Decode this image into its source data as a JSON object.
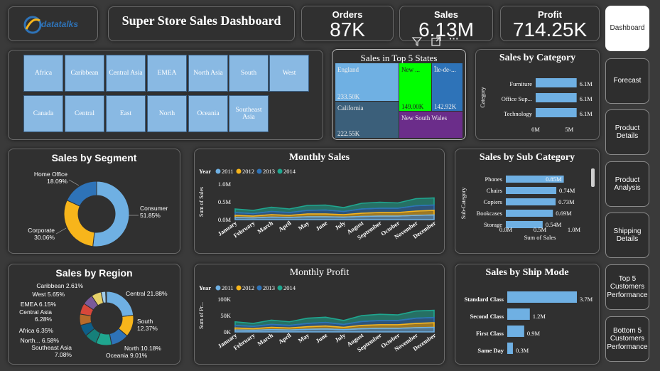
{
  "logo": {
    "text": "datatalks"
  },
  "header": {
    "title": "Super Store Sales Dashboard"
  },
  "kpis": {
    "orders": {
      "label": "Orders",
      "value": "87K"
    },
    "sales": {
      "label": "Sales",
      "value": "6.13M"
    },
    "profit": {
      "label": "Profit",
      "value": "714.25K"
    }
  },
  "nav": [
    {
      "label": "Dashboard",
      "active": true
    },
    {
      "label": "Forecast"
    },
    {
      "label": "Product Details"
    },
    {
      "label": "Product Analysis"
    },
    {
      "label": "Shipping Details"
    },
    {
      "label": "Top 5 Customers Performance"
    },
    {
      "label": "Bottom 5 Customers Performance"
    }
  ],
  "region_slicer": [
    "Africa",
    "Caribbean",
    "Central Asia",
    "EMEA",
    "North Asia",
    "South",
    "West",
    "Canada",
    "Central",
    "East",
    "North",
    "Oceania",
    "Southeast Asia"
  ],
  "visual_toolbar": {
    "icons": [
      "filter-icon",
      "focus-mode-icon",
      "more-options-icon"
    ],
    "more_label": "···"
  },
  "colors": {
    "blue": "#6fb0e3",
    "orange": "#f7b51b",
    "darkblue": "#2e73b8",
    "teal": "#1fa68f",
    "green": "#00ff00",
    "purple": "#6b2d8a",
    "slate": "#3b5f7a"
  },
  "chart_data": [
    {
      "id": "top5_states",
      "type": "treemap",
      "title": "Sales in Top 5 States",
      "items": [
        {
          "name": "England",
          "value": 233.5,
          "label": "233.50K",
          "color": "#6fb0e3"
        },
        {
          "name": "California",
          "value": 222.55,
          "label": "222.55K",
          "color": "#3b5f7a"
        },
        {
          "name": "New ...",
          "value": 149.0,
          "label": "149.00K",
          "color": "#00ff00"
        },
        {
          "name": "Île-de-...",
          "value": 142.92,
          "label": "142.92K",
          "color": "#2e73b8"
        },
        {
          "name": "New South Wales",
          "value": 140.0,
          "label": "",
          "color": "#6b2d8a"
        }
      ]
    },
    {
      "id": "by_category",
      "type": "bar",
      "orientation": "horizontal",
      "title": "Sales by Category",
      "ylabel": "Category",
      "categories": [
        "Furniture",
        "Office Sup...",
        "Technology"
      ],
      "values": [
        6.1,
        6.1,
        6.1
      ],
      "value_labels": [
        "6.1M",
        "6.1M",
        "6.1M"
      ],
      "xticks": [
        "0M",
        "5M"
      ],
      "xlim": [
        0,
        5.5
      ]
    },
    {
      "id": "by_segment",
      "type": "pie",
      "title": "Sales by Segment",
      "slices": [
        {
          "name": "Consumer",
          "value": 51.85,
          "label": "51.85%",
          "color": "#6fb0e3"
        },
        {
          "name": "Corporate",
          "value": 30.06,
          "label": "30.06%",
          "color": "#f7b51b"
        },
        {
          "name": "Home Office",
          "value": 18.09,
          "label": "18.09%",
          "color": "#2e73b8"
        }
      ]
    },
    {
      "id": "monthly_sales",
      "type": "area",
      "title": "Monthly Sales",
      "ylabel": "Sum of Sales",
      "legend_title": "Year",
      "categories": [
        "January",
        "February",
        "March",
        "April",
        "May",
        "June",
        "July",
        "August",
        "September",
        "October",
        "November",
        "December"
      ],
      "yticks": [
        "0.0M",
        "0.5M",
        "1.0M"
      ],
      "ylim": [
        0,
        1.0
      ],
      "series": [
        {
          "name": "2011",
          "color": "#6fb0e3",
          "values": [
            0.06,
            0.05,
            0.07,
            0.06,
            0.08,
            0.08,
            0.07,
            0.09,
            0.1,
            0.1,
            0.12,
            0.13
          ]
        },
        {
          "name": "2012",
          "color": "#f7b51b",
          "values": [
            0.06,
            0.05,
            0.07,
            0.06,
            0.08,
            0.08,
            0.07,
            0.09,
            0.1,
            0.1,
            0.12,
            0.13
          ]
        },
        {
          "name": "2013",
          "color": "#2e73b8",
          "values": [
            0.08,
            0.07,
            0.09,
            0.08,
            0.1,
            0.11,
            0.09,
            0.12,
            0.12,
            0.12,
            0.15,
            0.15
          ]
        },
        {
          "name": "2014",
          "color": "#1fa68f",
          "values": [
            0.1,
            0.09,
            0.12,
            0.1,
            0.14,
            0.14,
            0.11,
            0.16,
            0.17,
            0.15,
            0.2,
            0.2
          ]
        }
      ]
    },
    {
      "id": "by_subcategory",
      "type": "bar",
      "orientation": "horizontal",
      "title": "Sales by Sub Category",
      "ylabel": "Sub-Category",
      "xlabel": "Sum of Sales",
      "categories": [
        "Phones",
        "Chairs",
        "Copiers",
        "Bookcases",
        "Storage"
      ],
      "values": [
        0.85,
        0.74,
        0.73,
        0.69,
        0.54
      ],
      "value_labels": [
        "0.85M",
        "0.74M",
        "0.73M",
        "0.69M",
        "0.54M"
      ],
      "xticks": [
        "0.0M",
        "0.5M",
        "1.0M"
      ],
      "xlim": [
        0,
        1.0
      ]
    },
    {
      "id": "by_region",
      "type": "pie",
      "title": "Sales by Region",
      "slices": [
        {
          "name": "Central",
          "value": 21.88,
          "label": "Central 21.88%",
          "color": "#6fb0e3"
        },
        {
          "name": "South",
          "value": 12.37,
          "label": "South 12.37%",
          "color": "#f7b51b"
        },
        {
          "name": "North",
          "value": 10.18,
          "label": "North 10.18%",
          "color": "#2e73b8"
        },
        {
          "name": "Oceania",
          "value": 9.01,
          "label": "Oceania 9.01%",
          "color": "#1fa68f"
        },
        {
          "name": "Southeast Asia",
          "value": 7.08,
          "label": "Southeast Asia 7.08%",
          "color": "#16807a"
        },
        {
          "name": "North...",
          "value": 6.58,
          "label": "North... 6.58%",
          "color": "#0e5e88"
        },
        {
          "name": "Africa",
          "value": 6.35,
          "label": "Africa 6.35%",
          "color": "#b86b2a"
        },
        {
          "name": "Central Asia",
          "value": 6.28,
          "label": "Central Asia 6.28%",
          "color": "#d8473a"
        },
        {
          "name": "EMEA",
          "value": 6.15,
          "label": "EMEA 6.15%",
          "color": "#7a5a9a"
        },
        {
          "name": "West",
          "value": 5.65,
          "label": "West 5.65%",
          "color": "#e6d069"
        },
        {
          "name": "Caribbean",
          "value": 2.61,
          "label": "Caribbean 2.61%",
          "color": "#a0cbe8"
        },
        {
          "name": "Canada",
          "value": 0.5,
          "label": "",
          "color": "#56b4a4"
        }
      ]
    },
    {
      "id": "monthly_profit",
      "type": "area",
      "title": "Monthly Profit",
      "ylabel": "Sum of Pr...",
      "legend_title": "Year",
      "categories": [
        "January",
        "February",
        "March",
        "April",
        "May",
        "June",
        "July",
        "August",
        "September",
        "October",
        "November",
        "December"
      ],
      "yticks": [
        "0K",
        "50K",
        "100K"
      ],
      "ylim": [
        0,
        100
      ],
      "series": [
        {
          "name": "2011",
          "color": "#6fb0e3",
          "values": [
            6,
            5,
            7,
            6,
            8,
            9,
            7,
            10,
            11,
            11,
            13,
            14
          ]
        },
        {
          "name": "2012",
          "color": "#f7b51b",
          "values": [
            6,
            5,
            7,
            6,
            8,
            9,
            7,
            10,
            11,
            11,
            13,
            14
          ]
        },
        {
          "name": "2013",
          "color": "#2e73b8",
          "values": [
            8,
            7,
            9,
            8,
            10,
            11,
            9,
            12,
            13,
            13,
            16,
            16
          ]
        },
        {
          "name": "2014",
          "color": "#1fa68f",
          "values": [
            11,
            9,
            13,
            11,
            16,
            16,
            12,
            18,
            19,
            17,
            22,
            22
          ]
        }
      ]
    },
    {
      "id": "by_ship_mode",
      "type": "bar",
      "orientation": "horizontal",
      "title": "Sales by Ship Mode",
      "categories": [
        "Standard Class",
        "Second Class",
        "First Class",
        "Same Day"
      ],
      "values": [
        3.7,
        1.2,
        0.9,
        0.3
      ],
      "value_labels": [
        "3.7M",
        "1.2M",
        "0.9M",
        "0.3M"
      ],
      "xlim": [
        0,
        3.7
      ]
    }
  ]
}
